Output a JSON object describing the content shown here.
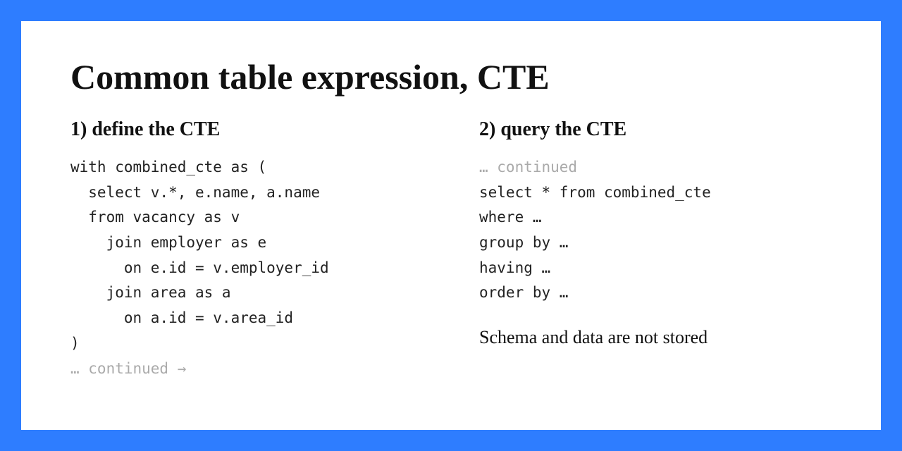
{
  "title": "Common table expression, CTE",
  "left": {
    "heading": "1) define the CTE",
    "code_lines": [
      "with combined_cte as (",
      "  select v.*, e.name, a.name",
      "  from vacancy as v",
      "    join employer as e",
      "      on e.id = v.employer_id",
      "    join area as a",
      "      on a.id = v.area_id",
      ")"
    ],
    "continued": "… continued →"
  },
  "right": {
    "heading": "2) query the CTE",
    "continued": "… continued",
    "code_lines": [
      "select * from combined_cte",
      "where …",
      "group by …",
      "having …",
      "order by …"
    ],
    "note": "Schema and data are not stored"
  }
}
